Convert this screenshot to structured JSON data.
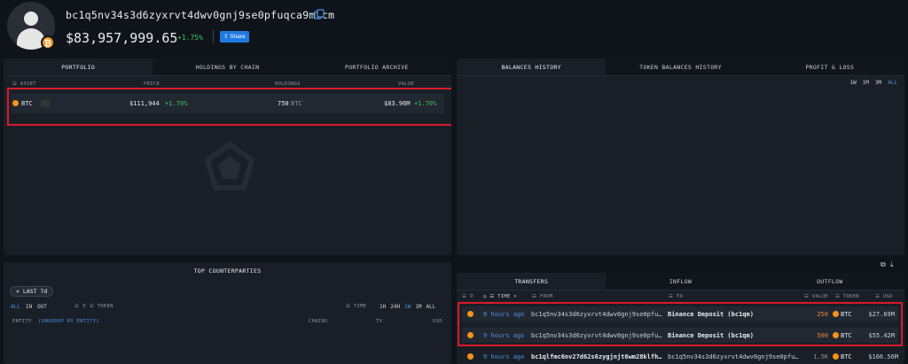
{
  "header": {
    "address": "bc1q5nv34s3d6zyxrvt4dwv0gnj9se0pfuqca9mfcm",
    "balance": "$83,957,999.65",
    "balance_change": "+1.75%",
    "share_label": "Share"
  },
  "portfolio": {
    "tabs": [
      "PORTFOLIO",
      "HOLDINGS BY CHAIN",
      "PORTFOLIO ARCHIVE"
    ],
    "columns": {
      "asset": "ASSET",
      "price": "PRICE",
      "holdings": "HOLDINGS",
      "value": "VALUE"
    },
    "row": {
      "asset": "BTC",
      "price": "$111,944",
      "price_change": "+1.70%",
      "holdings": "750",
      "holdings_unit": "BTC",
      "value": "$83.96M",
      "value_change": "+1.70%"
    }
  },
  "balances": {
    "tabs": [
      "BALANCES HISTORY",
      "TOKEN BALANCES HISTORY",
      "PROFIT & LOSS"
    ],
    "ranges": [
      "1W",
      "1M",
      "3M",
      "ALL"
    ],
    "active_range": "ALL"
  },
  "counterparties": {
    "title": "TOP COUNTERPARTIES",
    "filter_chip": "LAST 7d",
    "flow": [
      "ALL",
      "IN",
      "OUT"
    ],
    "token_label": "TOKEN",
    "time_label": "TIME",
    "ranges": [
      "1H",
      "24H",
      "1W",
      "1M",
      "ALL"
    ],
    "active_range": "1W",
    "columns": {
      "entity": "ENTITY",
      "ungroup": "[UNGROUP BY ENTITY]",
      "chains": "CHAINS",
      "tx": "TX",
      "usd": "USD"
    }
  },
  "transfers": {
    "tabs": [
      "TRANSFERS",
      "INFLOW",
      "OUTFLOW"
    ],
    "columns": {
      "time": "TIME",
      "from": "FROM",
      "to": "TO",
      "value": "VALUE",
      "token": "TOKEN",
      "usd": "USD"
    },
    "rows": [
      {
        "time": "8 hours ago",
        "from": "bc1q5nv34s3d6zyxrvt4dwv0gnj9se0pfu…",
        "to": "Binance Deposit (bc1qm)",
        "value": "250",
        "token": "BTC",
        "usd": "$27.69M"
      },
      {
        "time": "9 hours ago",
        "from": "bc1q5nv34s3d6zyxrvt4dwv0gnj9se0pfu…",
        "to": "Binance Deposit (bc1qm)",
        "value": "500",
        "token": "BTC",
        "usd": "$55.42M"
      },
      {
        "time": "9 hours ago",
        "from": "bc1qlfmc6nv27d62s6zygjnjt6wm28klfh…",
        "to": "bc1q5nv34s3d6zyxrvt4dwv0gnj9se0pfu…",
        "value": "1.5K",
        "token": "BTC",
        "usd": "$166.56M"
      }
    ]
  },
  "colors": {
    "accent": "#1f7ae0",
    "positive": "#34c759",
    "highlight": "#d91a2a",
    "btc": "#f7931a"
  }
}
